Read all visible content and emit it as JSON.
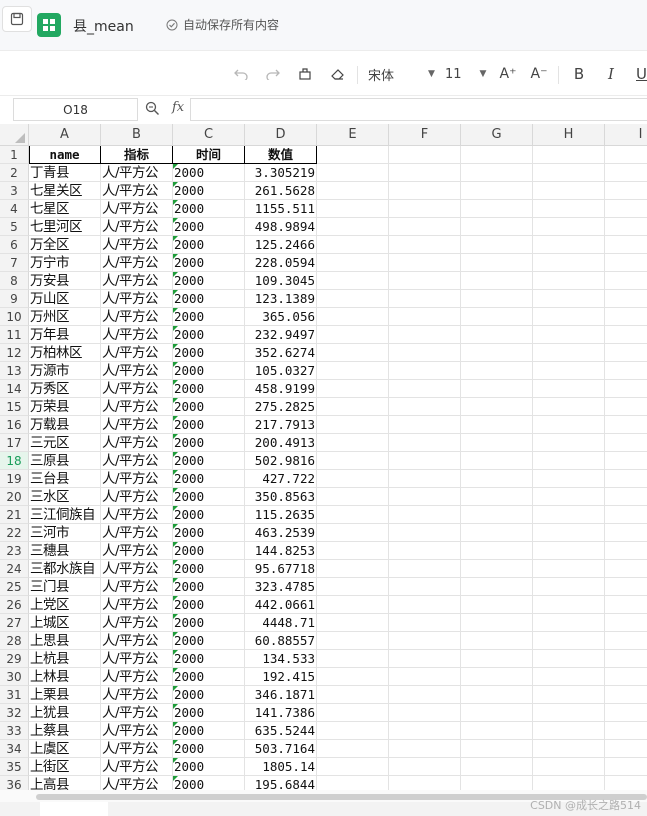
{
  "titlebar": {
    "doc_title": "县_mean",
    "autosave_text": "自动保存所有内容",
    "colors": {
      "app_icon": "#22a861"
    }
  },
  "toolbar": {
    "font_name": "宋体",
    "font_size": "11",
    "increase_font": "A⁺",
    "decrease_font": "A⁻",
    "bold": "B",
    "italic": "I",
    "underline": "U"
  },
  "formula_bar": {
    "cell_ref": "O18",
    "fx_label": "fx",
    "formula": ""
  },
  "sheet": {
    "columns": [
      "A",
      "B",
      "C",
      "D",
      "E",
      "F",
      "G",
      "H",
      "I"
    ],
    "selected_row": "18",
    "header_row": [
      "name",
      "指标",
      "时间",
      "数值"
    ],
    "rows": [
      {
        "n": "2",
        "a": "丁青县",
        "b": "人/平方公",
        "c": "2000",
        "d": "3.305219"
      },
      {
        "n": "3",
        "a": "七星关区",
        "b": "人/平方公",
        "c": "2000",
        "d": "261.5628"
      },
      {
        "n": "4",
        "a": "七星区",
        "b": "人/平方公",
        "c": "2000",
        "d": "1155.511"
      },
      {
        "n": "5",
        "a": "七里河区",
        "b": "人/平方公",
        "c": "2000",
        "d": "498.9894"
      },
      {
        "n": "6",
        "a": "万全区",
        "b": "人/平方公",
        "c": "2000",
        "d": "125.2466"
      },
      {
        "n": "7",
        "a": "万宁市",
        "b": "人/平方公",
        "c": "2000",
        "d": "228.0594"
      },
      {
        "n": "8",
        "a": "万安县",
        "b": "人/平方公",
        "c": "2000",
        "d": "109.3045"
      },
      {
        "n": "9",
        "a": "万山区",
        "b": "人/平方公",
        "c": "2000",
        "d": "123.1389"
      },
      {
        "n": "10",
        "a": "万州区",
        "b": "人/平方公",
        "c": "2000",
        "d": "365.056"
      },
      {
        "n": "11",
        "a": "万年县",
        "b": "人/平方公",
        "c": "2000",
        "d": "232.9497"
      },
      {
        "n": "12",
        "a": "万柏林区",
        "b": "人/平方公",
        "c": "2000",
        "d": "352.6274"
      },
      {
        "n": "13",
        "a": "万源市",
        "b": "人/平方公",
        "c": "2000",
        "d": "105.0327"
      },
      {
        "n": "14",
        "a": "万秀区",
        "b": "人/平方公",
        "c": "2000",
        "d": "458.9199"
      },
      {
        "n": "15",
        "a": "万荣县",
        "b": "人/平方公",
        "c": "2000",
        "d": "275.2825"
      },
      {
        "n": "16",
        "a": "万载县",
        "b": "人/平方公",
        "c": "2000",
        "d": "217.7913"
      },
      {
        "n": "17",
        "a": "三元区",
        "b": "人/平方公",
        "c": "2000",
        "d": "200.4913"
      },
      {
        "n": "18",
        "a": "三原县",
        "b": "人/平方公",
        "c": "2000",
        "d": "502.9816"
      },
      {
        "n": "19",
        "a": "三台县",
        "b": "人/平方公",
        "c": "2000",
        "d": "427.722"
      },
      {
        "n": "20",
        "a": "三水区",
        "b": "人/平方公",
        "c": "2000",
        "d": "350.8563"
      },
      {
        "n": "21",
        "a": "三江侗族自",
        "b": "人/平方公",
        "c": "2000",
        "d": "115.2635"
      },
      {
        "n": "22",
        "a": "三河市",
        "b": "人/平方公",
        "c": "2000",
        "d": "463.2539"
      },
      {
        "n": "23",
        "a": "三穗县",
        "b": "人/平方公",
        "c": "2000",
        "d": "144.8253"
      },
      {
        "n": "24",
        "a": "三都水族自",
        "b": "人/平方公",
        "c": "2000",
        "d": "95.67718"
      },
      {
        "n": "25",
        "a": "三门县",
        "b": "人/平方公",
        "c": "2000",
        "d": "323.4785"
      },
      {
        "n": "26",
        "a": "上党区",
        "b": "人/平方公",
        "c": "2000",
        "d": "442.0661"
      },
      {
        "n": "27",
        "a": "上城区",
        "b": "人/平方公",
        "c": "2000",
        "d": "4448.71"
      },
      {
        "n": "28",
        "a": "上思县",
        "b": "人/平方公",
        "c": "2000",
        "d": "60.88557"
      },
      {
        "n": "29",
        "a": "上杭县",
        "b": "人/平方公",
        "c": "2000",
        "d": "134.533"
      },
      {
        "n": "30",
        "a": "上林县",
        "b": "人/平方公",
        "c": "2000",
        "d": "192.415"
      },
      {
        "n": "31",
        "a": "上栗县",
        "b": "人/平方公",
        "c": "2000",
        "d": "346.1871"
      },
      {
        "n": "32",
        "a": "上犹县",
        "b": "人/平方公",
        "c": "2000",
        "d": "141.7386"
      },
      {
        "n": "33",
        "a": "上蔡县",
        "b": "人/平方公",
        "c": "2000",
        "d": "635.5244"
      },
      {
        "n": "34",
        "a": "上虞区",
        "b": "人/平方公",
        "c": "2000",
        "d": "503.7164"
      },
      {
        "n": "35",
        "a": "上街区",
        "b": "人/平方公",
        "c": "2000",
        "d": "1805.14"
      },
      {
        "n": "36",
        "a": "上高县",
        "b": "人/平方公",
        "c": "2000",
        "d": "195.6844"
      }
    ]
  },
  "watermark": "CSDN @成长之路514"
}
